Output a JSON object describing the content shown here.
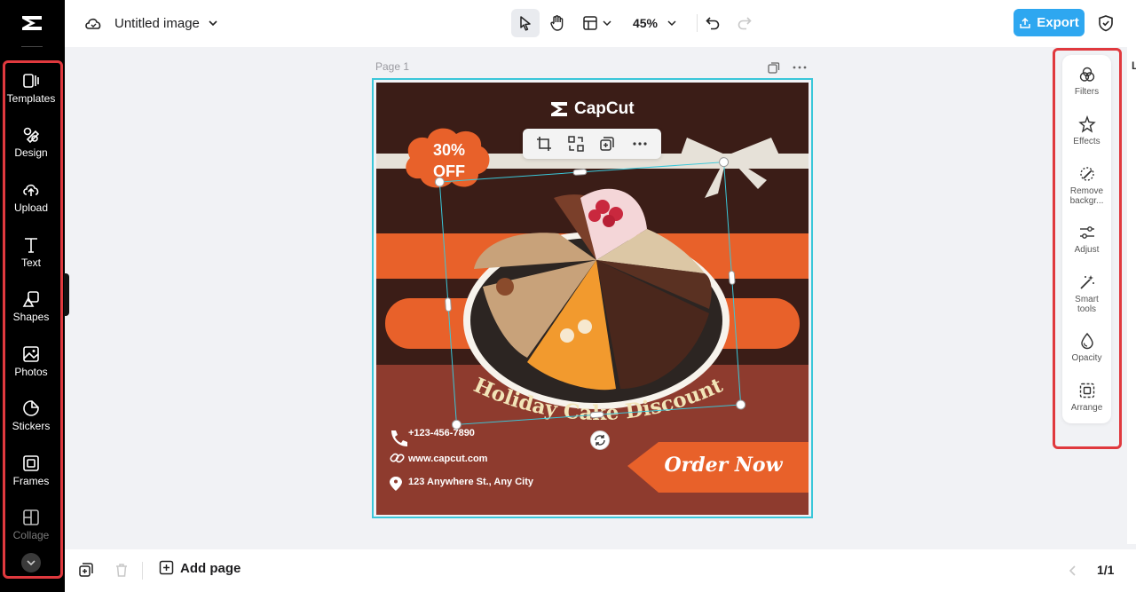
{
  "sidebar": {
    "items": [
      {
        "label": "Templates",
        "icon": "templates-icon"
      },
      {
        "label": "Design",
        "icon": "design-icon"
      },
      {
        "label": "Upload",
        "icon": "upload-icon"
      },
      {
        "label": "Text",
        "icon": "text-icon"
      },
      {
        "label": "Shapes",
        "icon": "shapes-icon"
      },
      {
        "label": "Photos",
        "icon": "photos-icon"
      },
      {
        "label": "Stickers",
        "icon": "stickers-icon"
      },
      {
        "label": "Frames",
        "icon": "frames-icon"
      },
      {
        "label": "Collage",
        "icon": "collage-icon"
      }
    ]
  },
  "topbar": {
    "title": "Untitled image",
    "zoom": "45%",
    "export_label": "Export"
  },
  "canvas": {
    "page_label": "Page 1",
    "design": {
      "brand": "CapCut",
      "badge": "30%\nOFF",
      "badge_line1": "30%",
      "badge_line2": "OFF",
      "headline": "Holiday Cake Discount",
      "phone": "+123-456-7890",
      "website": "www.capcut.com",
      "address": "123 Anywhere St., Any City",
      "cta": "Order Now"
    }
  },
  "right_panel": {
    "items": [
      {
        "label": "Filters",
        "icon": "filters-icon"
      },
      {
        "label": "Effects",
        "icon": "effects-icon"
      },
      {
        "label": "Remove backgr...",
        "icon": "remove-background-icon"
      },
      {
        "label": "Adjust",
        "icon": "adjust-icon"
      },
      {
        "label": "Smart tools",
        "icon": "smart-tools-icon"
      },
      {
        "label": "Opacity",
        "icon": "opacity-icon"
      },
      {
        "label": "Arrange",
        "icon": "arrange-icon"
      }
    ]
  },
  "bottombar": {
    "add_page_label": "Add page",
    "page_count": "1/1"
  },
  "colors": {
    "accent": "#2ea7f0",
    "highlight": "#e0393e",
    "selection": "#3ac7d9",
    "canvas_bg": "#3b1d17",
    "orange": "#e8612a"
  }
}
